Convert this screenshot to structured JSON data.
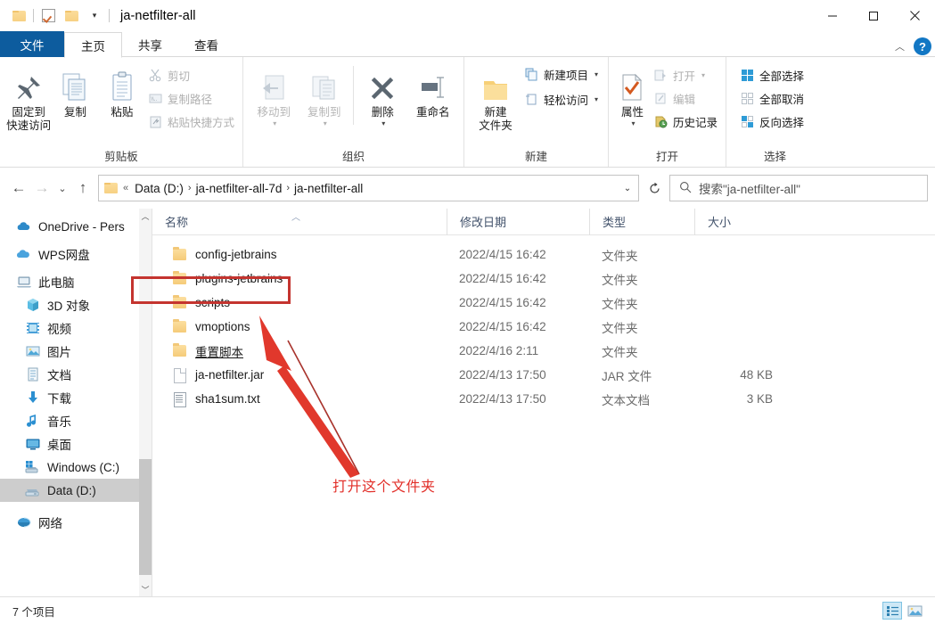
{
  "window": {
    "title": "ja-netfilter-all",
    "quick_access": [
      "folder-icon",
      "checkbox-checked-icon",
      "folder-icon",
      "dropdown-caret-icon"
    ],
    "controls": {
      "minimize": "minimize-icon",
      "maximize": "maximize-icon",
      "close": "close-icon"
    }
  },
  "tabs": [
    {
      "label": "文件",
      "state": "file-menu"
    },
    {
      "label": "主页",
      "state": "active"
    },
    {
      "label": "共享",
      "state": "normal"
    },
    {
      "label": "查看",
      "state": "normal"
    }
  ],
  "tab_right": {
    "collapse": "chevron-up-icon",
    "help": "?"
  },
  "ribbon": {
    "groups": [
      {
        "label": "剪贴板",
        "big": [
          {
            "label": "固定到\n快速访问",
            "icon": "pin-icon",
            "enabled": true
          },
          {
            "label": "复制",
            "icon": "copy-icon",
            "enabled": true
          },
          {
            "label": "粘贴",
            "icon": "paste-icon",
            "enabled": true
          }
        ],
        "small": [
          {
            "label": "剪切",
            "icon": "scissors-icon",
            "enabled": false
          },
          {
            "label": "复制路径",
            "icon": "copy-path-icon",
            "enabled": false
          },
          {
            "label": "粘贴快捷方式",
            "icon": "paste-shortcut-icon",
            "enabled": false
          }
        ]
      },
      {
        "label": "组织",
        "big": [
          {
            "label": "移动到",
            "icon": "move-to-icon",
            "enabled": false,
            "caret": true
          },
          {
            "label": "复制到",
            "icon": "copy-to-icon",
            "enabled": false,
            "caret": true
          },
          {
            "label": "删除",
            "icon": "delete-x-icon",
            "enabled": true,
            "caret": true
          },
          {
            "label": "重命名",
            "icon": "rename-icon",
            "enabled": true
          }
        ],
        "small": []
      },
      {
        "label": "新建",
        "big": [
          {
            "label": "新建\n文件夹",
            "icon": "new-folder-icon",
            "enabled": true
          }
        ],
        "small": [
          {
            "label": "新建项目",
            "icon": "new-item-icon",
            "enabled": true,
            "caret": true
          },
          {
            "label": "轻松访问",
            "icon": "easy-access-icon",
            "enabled": true,
            "caret": true
          }
        ]
      },
      {
        "label": "打开",
        "big": [
          {
            "label": "属性",
            "icon": "properties-icon",
            "enabled": true,
            "caret": true
          }
        ],
        "small": [
          {
            "label": "打开",
            "icon": "open-icon",
            "enabled": false,
            "caret": true
          },
          {
            "label": "编辑",
            "icon": "edit-icon",
            "enabled": false
          },
          {
            "label": "历史记录",
            "icon": "history-icon",
            "enabled": true
          }
        ]
      },
      {
        "label": "选择",
        "big": [],
        "small": [
          {
            "label": "全部选择",
            "icon": "select-all-icon",
            "enabled": true
          },
          {
            "label": "全部取消",
            "icon": "select-none-icon",
            "enabled": true
          },
          {
            "label": "反向选择",
            "icon": "invert-selection-icon",
            "enabled": true
          }
        ]
      }
    ]
  },
  "address_bar": {
    "back": "back-arrow-icon",
    "forward": "forward-arrow-icon",
    "recent": "dropdown-caret-icon",
    "up": "up-arrow-icon",
    "folder_icon": "folder-icon",
    "prefix": "«",
    "crumbs": [
      "Data (D:)",
      "ja-netfilter-all-7d",
      "ja-netfilter-all"
    ],
    "dropdown": "chevron-down-icon",
    "refresh": "refresh-icon",
    "search_icon": "search-icon",
    "search_placeholder": "搜索\"ja-netfilter-all\""
  },
  "nav_pane": {
    "items": [
      {
        "label": "OneDrive - Pers",
        "icon": "onedrive-cloud-icon",
        "level": 1,
        "selected": false
      },
      {
        "label": "WPS网盘",
        "icon": "wps-cloud-icon",
        "level": 1,
        "selected": false
      },
      {
        "label": "此电脑",
        "icon": "this-pc-icon",
        "level": 1,
        "selected": false
      },
      {
        "label": "3D 对象",
        "icon": "3d-objects-icon",
        "level": 2,
        "selected": false
      },
      {
        "label": "视频",
        "icon": "videos-icon",
        "level": 2,
        "selected": false
      },
      {
        "label": "图片",
        "icon": "pictures-icon",
        "level": 2,
        "selected": false
      },
      {
        "label": "文档",
        "icon": "documents-icon",
        "level": 2,
        "selected": false
      },
      {
        "label": "下载",
        "icon": "downloads-icon",
        "level": 2,
        "selected": false
      },
      {
        "label": "音乐",
        "icon": "music-icon",
        "level": 2,
        "selected": false
      },
      {
        "label": "桌面",
        "icon": "desktop-icon",
        "level": 2,
        "selected": false
      },
      {
        "label": "Windows (C:)",
        "icon": "drive-icon",
        "level": 2,
        "selected": false
      },
      {
        "label": "Data (D:)",
        "icon": "drive-icon",
        "level": 2,
        "selected": true
      },
      {
        "label": "网络",
        "icon": "network-icon",
        "level": 1,
        "selected": false
      }
    ]
  },
  "file_list": {
    "columns": [
      "名称",
      "修改日期",
      "类型",
      "大小"
    ],
    "sort_column": "名称",
    "sort_direction": "asc",
    "rows": [
      {
        "name": "config-jetbrains",
        "icon": "folder-icon",
        "date": "2022/4/15 16:42",
        "type": "文件夹",
        "size": ""
      },
      {
        "name": "plugins-jetbrains",
        "icon": "folder-icon",
        "date": "2022/4/15 16:42",
        "type": "文件夹",
        "size": ""
      },
      {
        "name": "scripts",
        "icon": "folder-icon",
        "date": "2022/4/15 16:42",
        "type": "文件夹",
        "size": "",
        "highlighted": true
      },
      {
        "name": "vmoptions",
        "icon": "folder-icon",
        "date": "2022/4/15 16:42",
        "type": "文件夹",
        "size": ""
      },
      {
        "name": "重置脚本",
        "icon": "folder-icon",
        "date": "2022/4/16 2:11",
        "type": "文件夹",
        "size": "",
        "underline": true
      },
      {
        "name": "ja-netfilter.jar",
        "icon": "jar-file-icon",
        "date": "2022/4/13 17:50",
        "type": "JAR 文件",
        "size": "48 KB"
      },
      {
        "name": "sha1sum.txt",
        "icon": "text-file-icon",
        "date": "2022/4/13 17:50",
        "type": "文本文档",
        "size": "3 KB"
      }
    ]
  },
  "annotation": {
    "text": "打开这个文件夹",
    "color": "#e2302a",
    "box_color": "#c4342f",
    "box_target": "scripts"
  },
  "status_bar": {
    "item_count": "7 个项目",
    "view_buttons": [
      {
        "name": "details-view",
        "icon": "details-view-icon",
        "active": true
      },
      {
        "name": "large-icons-view",
        "icon": "large-icons-view-icon",
        "active": false
      }
    ]
  },
  "colors": {
    "file_tab_blue": "#0d5c9e",
    "selection_gray": "#cdcdcd",
    "annotation_red": "#e2302a",
    "column_header_text": "#42526b"
  }
}
